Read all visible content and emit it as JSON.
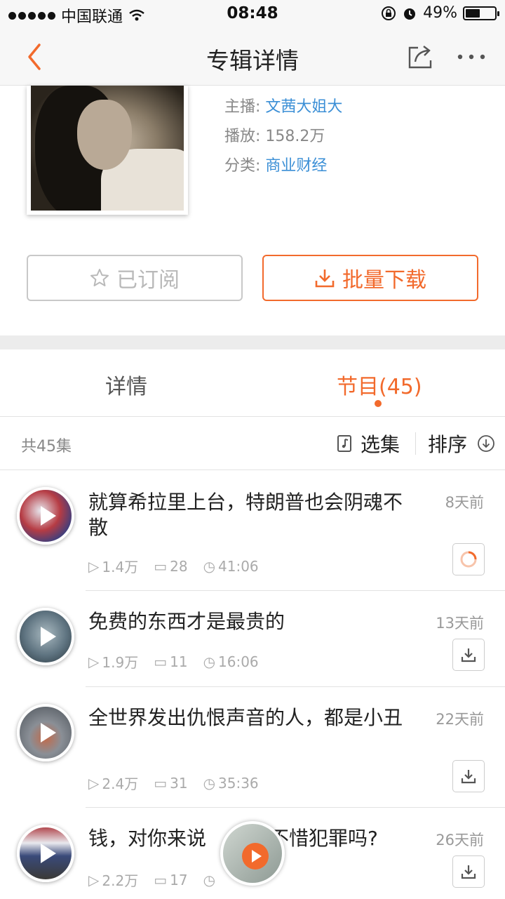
{
  "status_bar": {
    "carrier": "中国联通",
    "time": "08:48",
    "battery": "49%"
  },
  "nav": {
    "title": "专辑详情"
  },
  "album": {
    "host_label": "主播:",
    "host": "文茜大姐大",
    "plays_label": "播放:",
    "plays": "158.2万",
    "category_label": "分类:",
    "category": "商业财经"
  },
  "actions": {
    "subscribed": "已订阅",
    "batch_download": "批量下载"
  },
  "tabs": {
    "detail": "详情",
    "programs": "节目(45)"
  },
  "list_header": {
    "count": "共45集",
    "select": "选集",
    "sort": "排序"
  },
  "episodes": [
    {
      "title": "就算希拉里上台，特朗普也会阴魂不散",
      "ago": "8天前",
      "plays": "1.4万",
      "comments": "28",
      "duration": "41:06"
    },
    {
      "title": "免费的东西才是最贵的",
      "ago": "13天前",
      "plays": "1.9万",
      "comments": "11",
      "duration": "16:06"
    },
    {
      "title": "全世界发出仇恨声音的人，都是小丑",
      "ago": "22天前",
      "plays": "2.4万",
      "comments": "31",
      "duration": "35:36"
    },
    {
      "title": "钱，对你来说",
      "title_tail": "不惜犯罪吗?",
      "ago": "26天前",
      "plays": "2.2万",
      "comments": "17",
      "duration": ""
    }
  ],
  "colors": {
    "accent": "#f26a2c",
    "link": "#3b8fd6"
  }
}
